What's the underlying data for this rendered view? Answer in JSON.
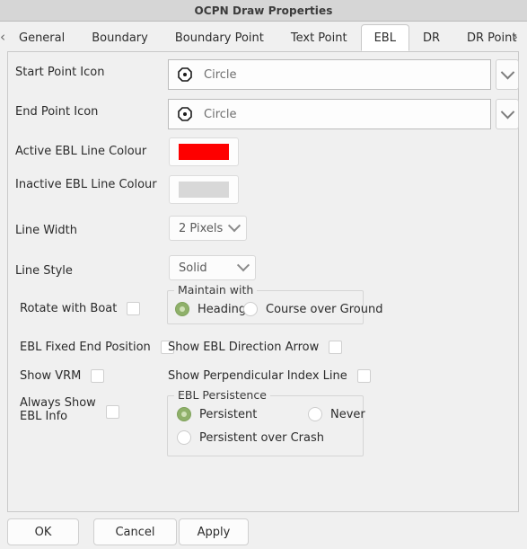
{
  "window": {
    "title": "OCPN Draw Properties"
  },
  "tabbar": {
    "prev_arrow": "‹",
    "next_arrow": "›",
    "tabs": [
      {
        "label": "General",
        "active": false
      },
      {
        "label": "Boundary",
        "active": false
      },
      {
        "label": "Boundary Point",
        "active": false
      },
      {
        "label": "Text Point",
        "active": false
      },
      {
        "label": "EBL",
        "active": true
      },
      {
        "label": "DR",
        "active": false
      },
      {
        "label": "DR Point",
        "active": false
      }
    ]
  },
  "form": {
    "start_point_icon": {
      "label": "Start Point Icon",
      "value": "Circle",
      "icon": "circle-dot-icon"
    },
    "end_point_icon": {
      "label": "End Point Icon",
      "value": "Circle",
      "icon": "circle-dot-icon"
    },
    "active_colour": {
      "label": "Active EBL Line Colour",
      "colour": "#fe0000"
    },
    "inactive_colour": {
      "label": "Inactive EBL Line Colour",
      "colour": "#d8d8d8"
    },
    "line_width": {
      "label": "Line Width",
      "value": "2 Pixels"
    },
    "line_style": {
      "label": "Line Style",
      "value": "Solid"
    },
    "rotate_with_boat": {
      "label": "Rotate with Boat",
      "checked": false
    },
    "ebl_fixed_end_position": {
      "label": "EBL Fixed End Position",
      "checked": false
    },
    "show_vrm": {
      "label": "Show VRM",
      "checked": false
    },
    "always_show_ebl_info": {
      "label": "Always Show\nEBL Info",
      "label_line1": "Always Show",
      "label_line2": "EBL Info",
      "checked": false
    },
    "show_ebl_direction_arrow": {
      "label": "Show EBL Direction Arrow",
      "checked": false
    },
    "show_perpendicular_index_line": {
      "label": "Show Perpendicular Index Line",
      "checked": false
    },
    "maintain_with": {
      "title": "Maintain with",
      "options": [
        {
          "label": "Heading",
          "selected": true
        },
        {
          "label": "Course over Ground",
          "selected": false
        }
      ]
    },
    "ebl_persistence": {
      "title": "EBL Persistence",
      "options": [
        {
          "label": "Persistent",
          "selected": true
        },
        {
          "label": "Never",
          "selected": false
        },
        {
          "label": "Persistent over Crash",
          "selected": false
        }
      ]
    }
  },
  "buttons": {
    "ok": "OK",
    "cancel": "Cancel",
    "apply": "Apply"
  },
  "colors": {
    "accent_green": "#8fb06a",
    "titlebar_bg": "#d6d6d6",
    "panel_bg": "#f0f0f0"
  }
}
